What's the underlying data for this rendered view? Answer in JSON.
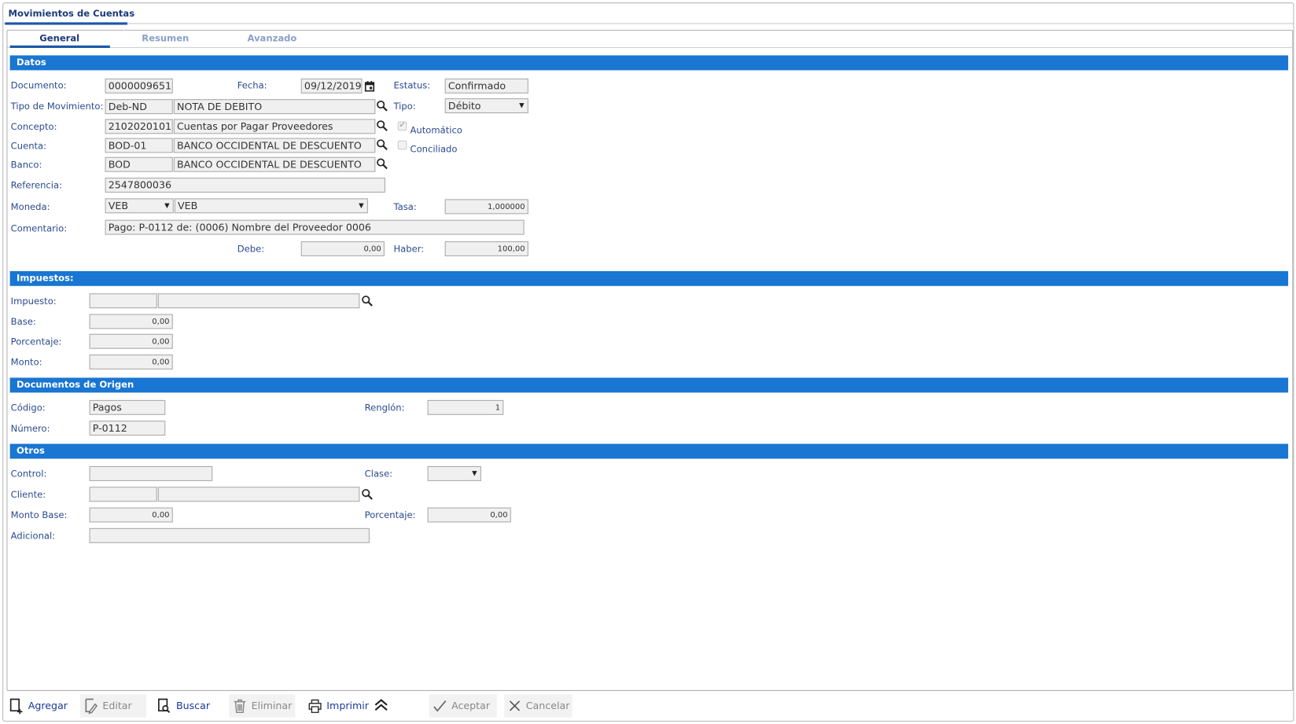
{
  "window": {
    "title": "Movimientos de Cuentas"
  },
  "tabs": [
    {
      "label": "General",
      "active": true
    },
    {
      "label": "Resumen"
    },
    {
      "label": "Avanzado"
    }
  ],
  "datos": {
    "header": "Datos",
    "documento": {
      "label": "Documento:",
      "value": "0000009651"
    },
    "fecha": {
      "label": "Fecha:",
      "value": "09/12/2019"
    },
    "estatus": {
      "label": "Estatus:",
      "value": "Confirmado"
    },
    "tipo_movimiento": {
      "label": "Tipo de Movimiento:",
      "code": "Deb-ND",
      "name": "NOTA DE DEBITO"
    },
    "tipo": {
      "label": "Tipo:",
      "value": "Débito"
    },
    "concepto": {
      "label": "Concepto:",
      "code": "2102020101",
      "name": "Cuentas por Pagar Proveedores"
    },
    "automatico": {
      "label": "Automático",
      "checked": true
    },
    "cuenta": {
      "label": "Cuenta:",
      "code": "BOD-01",
      "name": "BANCO OCCIDENTAL DE DESCUENTO"
    },
    "conciliado": {
      "label": "Conciliado",
      "checked": false
    },
    "banco": {
      "label": "Banco:",
      "code": "BOD",
      "name": "BANCO OCCIDENTAL DE DESCUENTO"
    },
    "referencia": {
      "label": "Referencia:",
      "value": "2547800036"
    },
    "moneda": {
      "label": "Moneda:",
      "code": "VEB",
      "name": "VEB"
    },
    "tasa": {
      "label": "Tasa:",
      "value": "1,000000"
    },
    "comentario": {
      "label": "Comentario:",
      "value": "Pago: P-0112 de: (0006) Nombre del Proveedor 0006"
    },
    "debe": {
      "label": "Debe:",
      "value": "0,00"
    },
    "haber": {
      "label": "Haber:",
      "value": "100,00"
    }
  },
  "impuestos": {
    "header": "Impuestos:",
    "impuesto": {
      "label": "Impuesto:",
      "code": "",
      "name": ""
    },
    "base": {
      "label": "Base:",
      "value": "0,00"
    },
    "porcentaje": {
      "label": "Porcentaje:",
      "value": "0,00"
    },
    "monto": {
      "label": "Monto:",
      "value": "0,00"
    }
  },
  "origen": {
    "header": "Documentos de Origen",
    "codigo": {
      "label": "Código:",
      "value": "Pagos"
    },
    "renglon": {
      "label": "Renglón:",
      "value": "1"
    },
    "numero": {
      "label": "Número:",
      "value": "P-0112"
    }
  },
  "otros": {
    "header": "Otros",
    "control": {
      "label": "Control:",
      "value": ""
    },
    "clase": {
      "label": "Clase:",
      "value": ""
    },
    "cliente": {
      "label": "Cliente:",
      "code": "",
      "name": ""
    },
    "monto_base": {
      "label": "Monto Base:",
      "value": "0,00"
    },
    "porcentaje": {
      "label": "Porcentaje:",
      "value": "0,00"
    },
    "adicional": {
      "label": "Adicional:",
      "value": ""
    }
  },
  "toolbar": {
    "agregar": "Agregar",
    "editar": "Editar",
    "buscar": "Buscar",
    "eliminar": "Eliminar",
    "imprimir": "Imprimir",
    "aceptar": "Aceptar",
    "cancelar": "Cancelar"
  },
  "colors": {
    "section": "#1976d2",
    "label": "#2a4a8f",
    "active_tab": "#1b57a8"
  }
}
